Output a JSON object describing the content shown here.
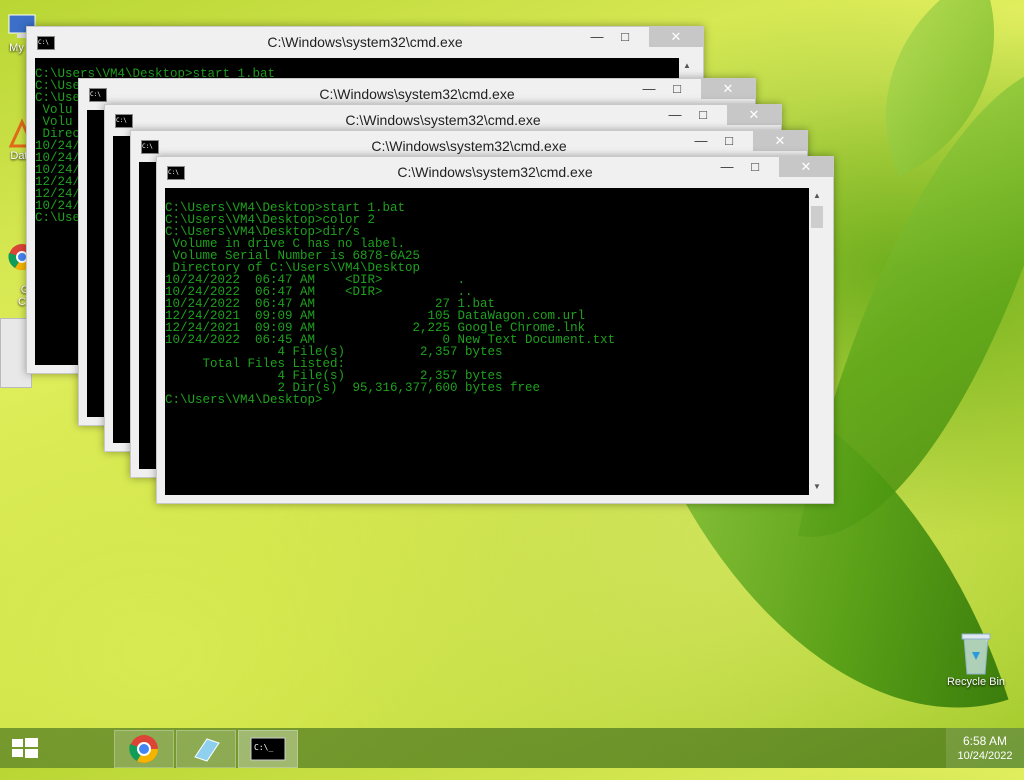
{
  "desktop": {
    "icons": [
      {
        "label": "My C"
      },
      {
        "label": "Data"
      },
      {
        "label": "G\nC"
      },
      {
        "label": "Recycle Bin"
      }
    ]
  },
  "windows": [
    {
      "title": "C:\\Windows\\system32\\cmd.exe"
    },
    {
      "title": "C:\\Windows\\system32\\cmd.exe"
    },
    {
      "title": "C:\\Windows\\system32\\cmd.exe"
    },
    {
      "title": "C:\\Windows\\system32\\cmd.exe"
    },
    {
      "title": "C:\\Windows\\system32\\cmd.exe"
    }
  ],
  "active_console": {
    "lines": [
      "C:\\Users\\VM4\\Desktop>start 1.bat",
      "",
      "C:\\Users\\VM4\\Desktop>color 2",
      "",
      "C:\\Users\\VM4\\Desktop>dir/s",
      " Volume in drive C has no label.",
      " Volume Serial Number is 6878-6A25",
      "",
      " Directory of C:\\Users\\VM4\\Desktop",
      "",
      "10/24/2022  06:47 AM    <DIR>          .",
      "10/24/2022  06:47 AM    <DIR>          ..",
      "10/24/2022  06:47 AM                27 1.bat",
      "12/24/2021  09:09 AM               105 DataWagon.com.url",
      "12/24/2021  09:09 AM             2,225 Google Chrome.lnk",
      "10/24/2022  06:45 AM                 0 New Text Document.txt",
      "               4 File(s)          2,357 bytes",
      "",
      "     Total Files Listed:",
      "               4 File(s)          2,357 bytes",
      "               2 Dir(s)  95,316,377,600 bytes free",
      "",
      "C:\\Users\\VM4\\Desktop>"
    ]
  },
  "back_console": {
    "lines": [
      "C:\\Users\\VM4\\Desktop>start 1.bat",
      "",
      "C:\\Use",
      "",
      "C:\\Use",
      " Volu",
      " Volu",
      "",
      " Direc",
      "",
      "10/24/",
      "10/24/",
      "10/24/",
      "12/24/",
      "12/24/",
      "10/24/",
      "",
      "",
      "",
      "",
      "",
      "",
      "C:\\Use"
    ]
  },
  "taskbar": {
    "time": "6:58 AM",
    "date": "10/24/2022"
  }
}
